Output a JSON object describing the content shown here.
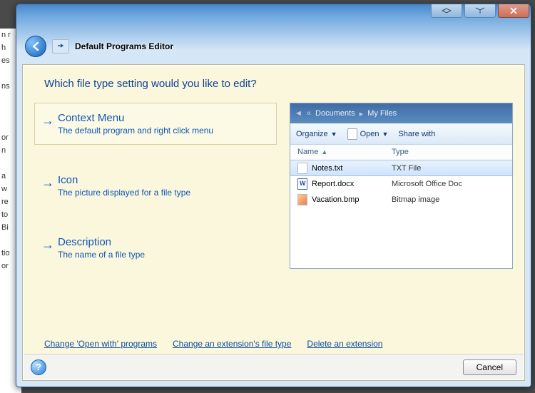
{
  "window": {
    "title": "Default Programs Editor"
  },
  "heading": "Which file type setting would you like to edit?",
  "options": [
    {
      "title": "Context Menu",
      "desc": "The default program and right click menu",
      "selected": true
    },
    {
      "title": "Icon",
      "desc": "The picture displayed for a file type",
      "selected": false
    },
    {
      "title": "Description",
      "desc": "The name of a file type",
      "selected": false
    }
  ],
  "preview": {
    "breadcrumb": {
      "a": "Documents",
      "b": "My Files"
    },
    "toolbar": {
      "organize": "Organize",
      "open": "Open",
      "share": "Share with"
    },
    "columns": {
      "name": "Name",
      "type": "Type"
    },
    "files": [
      {
        "name": "Notes.txt",
        "type": "TXT File",
        "icon": "txt",
        "selected": true
      },
      {
        "name": "Report.docx",
        "type": "Microsoft Office Doc",
        "icon": "docx",
        "selected": false
      },
      {
        "name": "Vacation.bmp",
        "type": "Bitmap image",
        "icon": "bmp",
        "selected": false
      }
    ]
  },
  "links": {
    "change_open_with": "Change 'Open with' programs",
    "change_ext": "Change an extension's file type",
    "delete_ext": "Delete an extension"
  },
  "buttons": {
    "cancel": "Cancel",
    "help": "?"
  }
}
